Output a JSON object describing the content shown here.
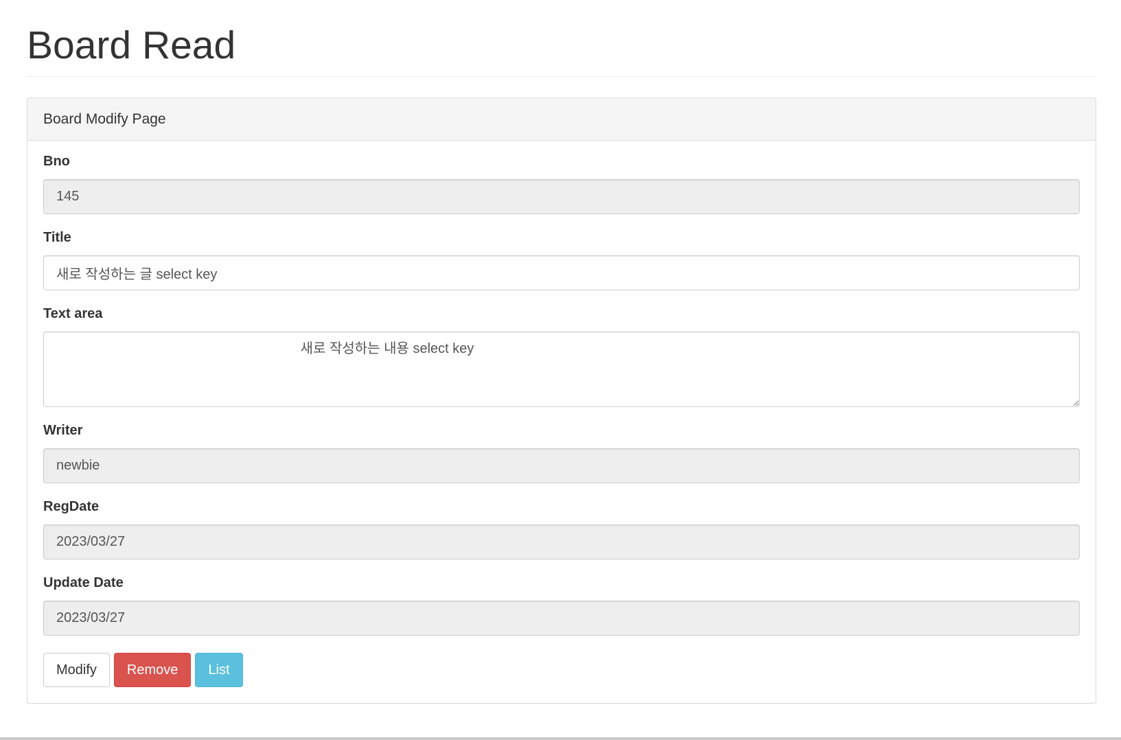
{
  "page": {
    "title": "Board Read"
  },
  "panel": {
    "heading": "Board Modify Page"
  },
  "fields": {
    "bno": {
      "label": "Bno",
      "value": "145"
    },
    "title": {
      "label": "Title",
      "value": "새로 작성하는 글 select key"
    },
    "content": {
      "label": "Text area",
      "value": "\t\t\t\t\t\t\t\t새로 작성하는 내용 select key"
    },
    "writer": {
      "label": "Writer",
      "value": "newbie"
    },
    "regdate": {
      "label": "RegDate",
      "value": "2023/03/27"
    },
    "updatedate": {
      "label": "Update Date",
      "value": "2023/03/27"
    }
  },
  "buttons": {
    "modify": "Modify",
    "remove": "Remove",
    "list": "List"
  },
  "colors": {
    "danger": "#d9534f",
    "info": "#5bc0de",
    "readonly_bg": "#eeeeee"
  }
}
